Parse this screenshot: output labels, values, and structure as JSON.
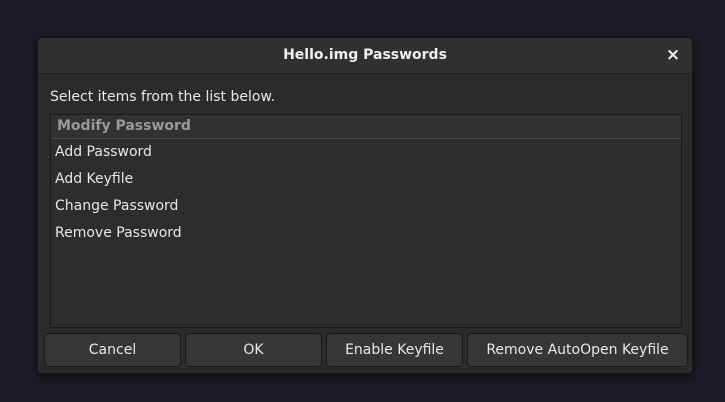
{
  "dialog": {
    "title": "Hello.img Passwords",
    "close_glyph": "×",
    "instruction": "Select items from the list below."
  },
  "list": {
    "header": "Modify Password",
    "items": [
      {
        "label": "Add Password"
      },
      {
        "label": "Add Keyfile"
      },
      {
        "label": "Change Password"
      },
      {
        "label": "Remove Password"
      }
    ]
  },
  "buttons": {
    "cancel": "Cancel",
    "ok": "OK",
    "enable_keyfile": "Enable Keyfile",
    "remove_autoopen_keyfile": "Remove AutoOpen Keyfile"
  },
  "icons": {
    "close": "close-icon"
  },
  "colors": {
    "desktop_background": "#1c1b27",
    "dialog_background": "#2b2b2b",
    "header_text": "#9a9a9a"
  }
}
